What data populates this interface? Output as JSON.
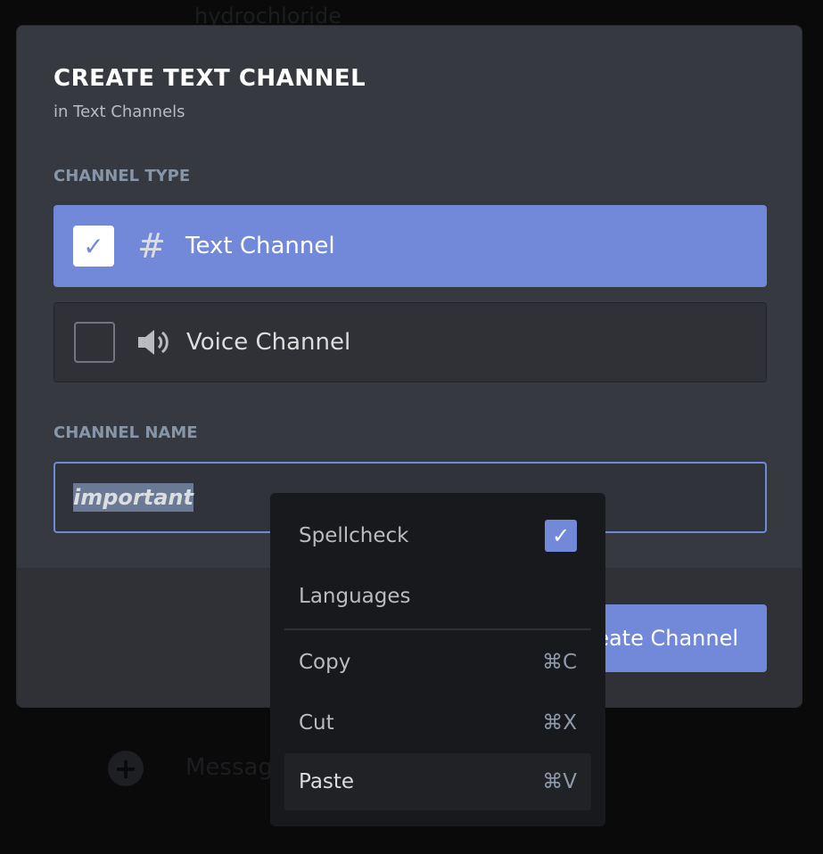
{
  "background": {
    "channel_text": "hydrochloride",
    "message_placeholder": "Message"
  },
  "modal": {
    "title": "CREATE TEXT CHANNEL",
    "subtitle": "in Text Channels",
    "channel_type_label": "CHANNEL TYPE",
    "options": [
      {
        "label": "Text Channel",
        "checked": true,
        "icon": "hash-icon"
      },
      {
        "label": "Voice Channel",
        "checked": false,
        "icon": "speaker-icon"
      }
    ],
    "channel_name_label": "CHANNEL NAME",
    "channel_name_value": "important",
    "create_button": "Create Channel"
  },
  "context_menu": {
    "spellcheck": {
      "label": "Spellcheck",
      "checked": true
    },
    "languages": "Languages",
    "items": [
      {
        "label": "Copy",
        "shortcut": "⌘C"
      },
      {
        "label": "Cut",
        "shortcut": "⌘X"
      },
      {
        "label": "Paste",
        "shortcut": "⌘V"
      }
    ]
  },
  "colors": {
    "accent": "#7289da",
    "modal_bg": "#36393f",
    "menu_bg": "#18191c"
  }
}
